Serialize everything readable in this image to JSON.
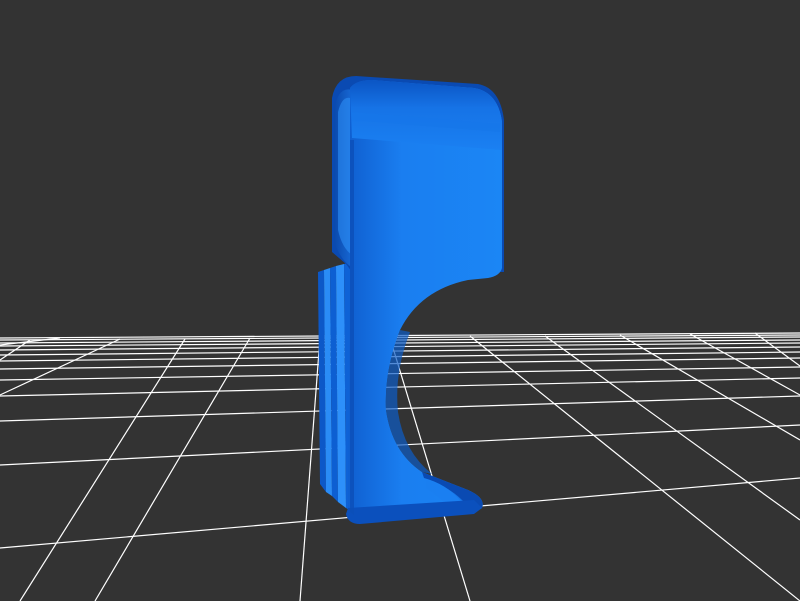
{
  "viewer": {
    "background_color": "#333333",
    "grid_color": "#ffffff",
    "model_color": "#1a7ef0",
    "model_shadow_color": "#0a4fb8",
    "model_highlight_color": "#3a9cff",
    "grid_visible": true
  },
  "scene": {
    "object_icon": "3d-model-part",
    "object_type": "clip-hook"
  }
}
